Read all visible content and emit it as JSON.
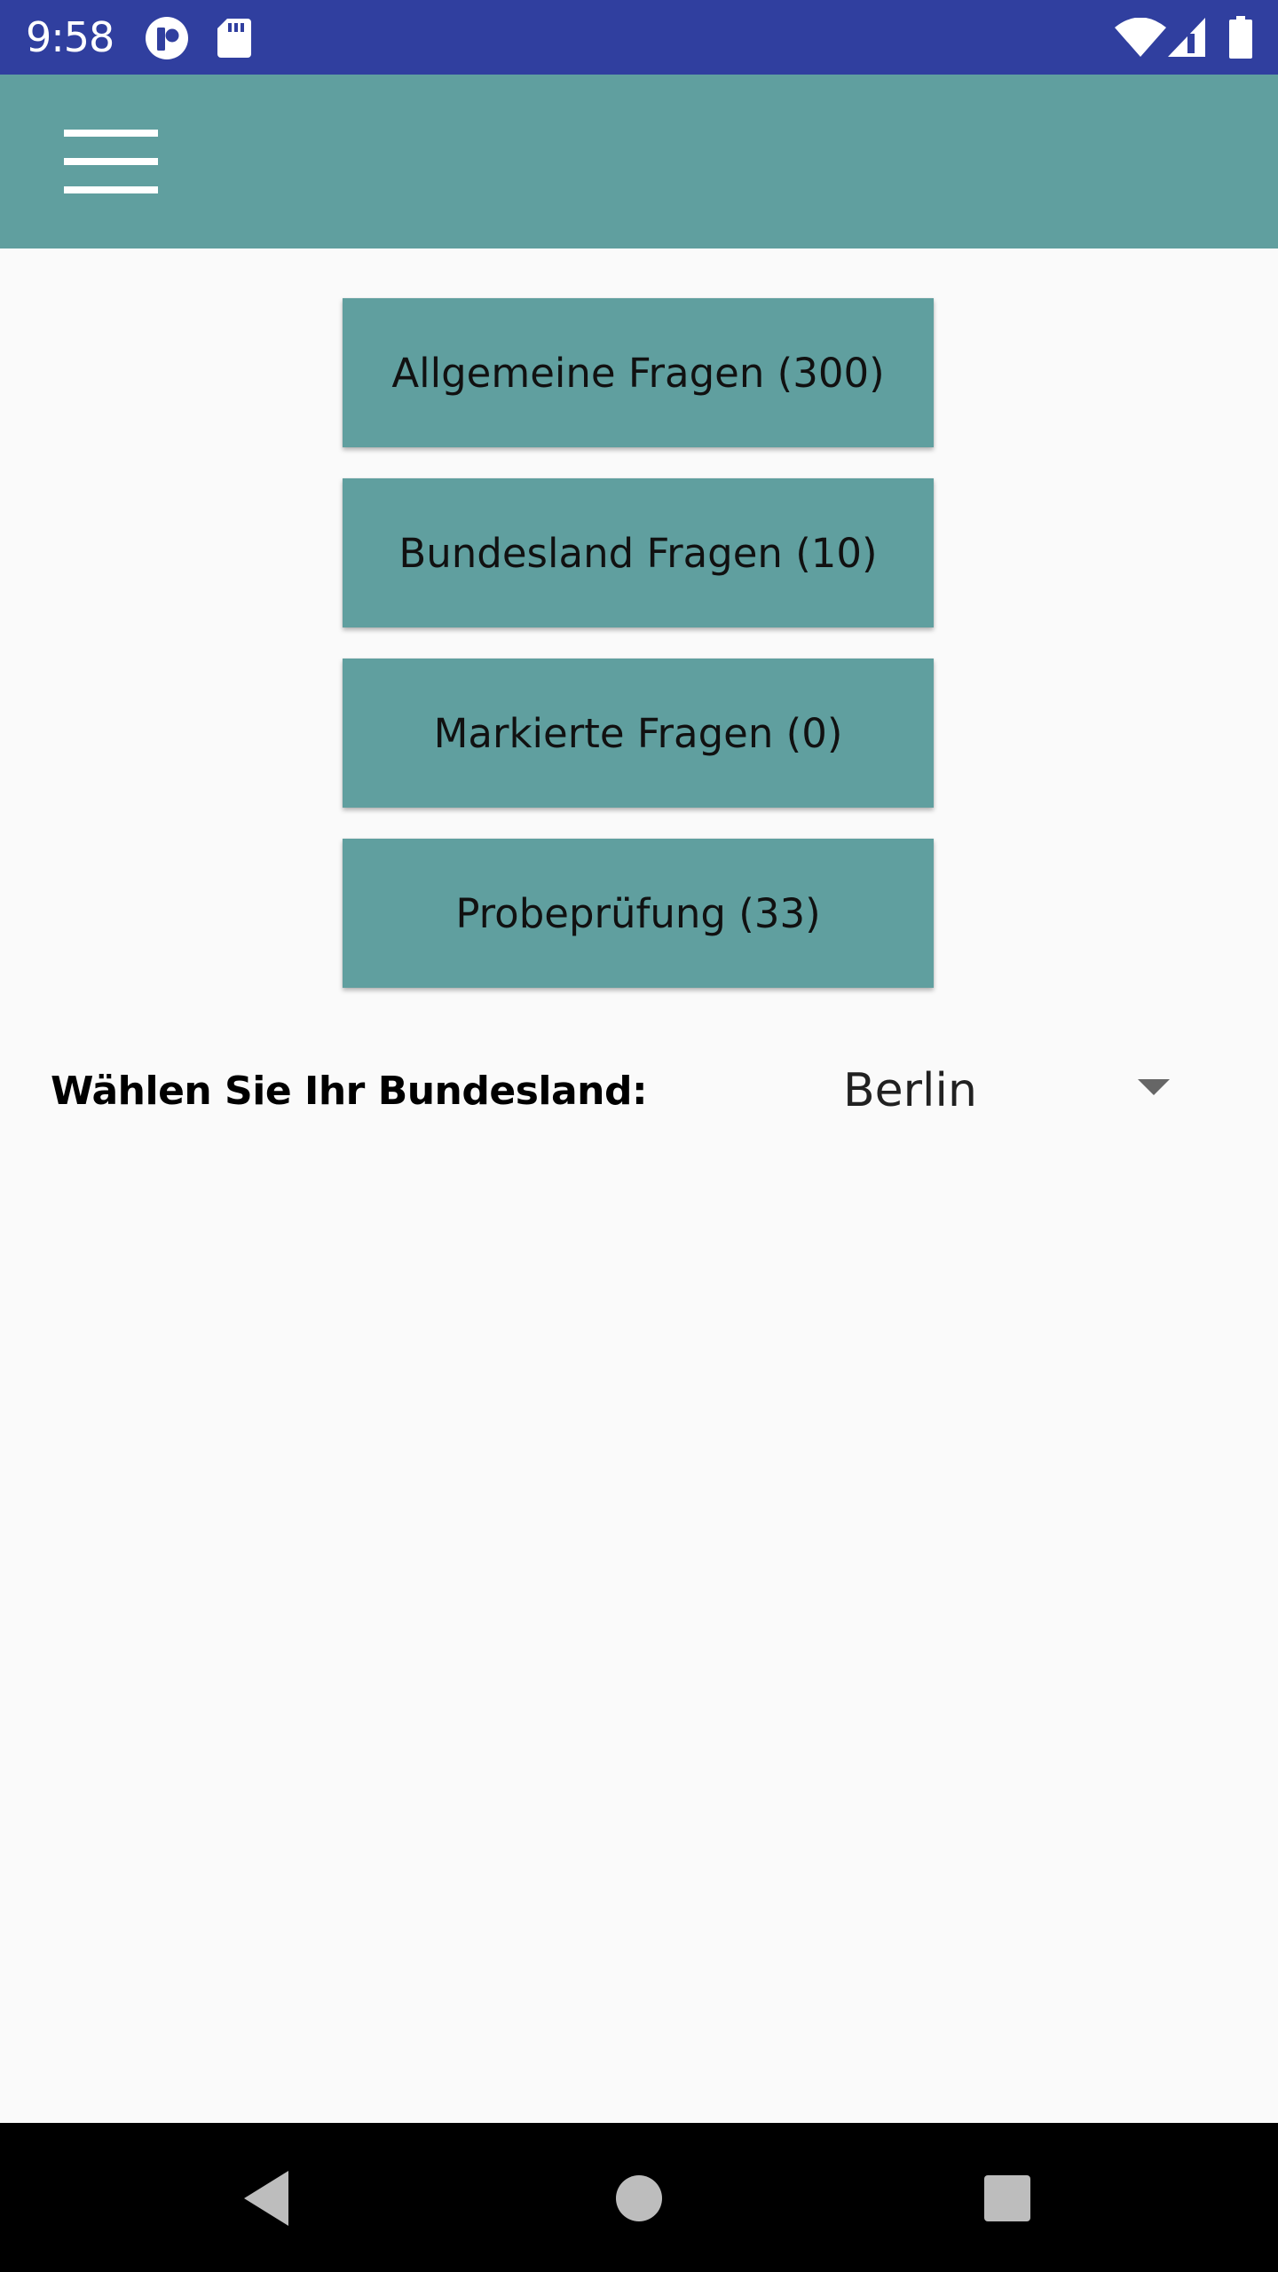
{
  "status_bar": {
    "time": "9:58",
    "background": "#303f9f",
    "icons_left": [
      "app-notification-icon",
      "sd-card-icon"
    ],
    "icons_right": [
      "wifi-icon",
      "cell-signal-icon",
      "battery-icon"
    ]
  },
  "app_bar": {
    "background": "#609f9f",
    "menu_icon": "hamburger-menu-icon"
  },
  "main": {
    "buttons": [
      {
        "label": "Allgemeine Fragen (300)"
      },
      {
        "label": "Bundesland Fragen (10)"
      },
      {
        "label": "Markierte Fragen (0)"
      },
      {
        "label": "Probeprüfung (33)"
      }
    ],
    "button_color": "#609f9f",
    "state_selector": {
      "label": "Wählen Sie Ihr Bundesland:",
      "selected": "Berlin",
      "arrow_icon": "dropdown-arrow-icon"
    }
  },
  "nav_bar": {
    "icons": [
      "back-icon",
      "home-icon",
      "recents-icon"
    ]
  }
}
